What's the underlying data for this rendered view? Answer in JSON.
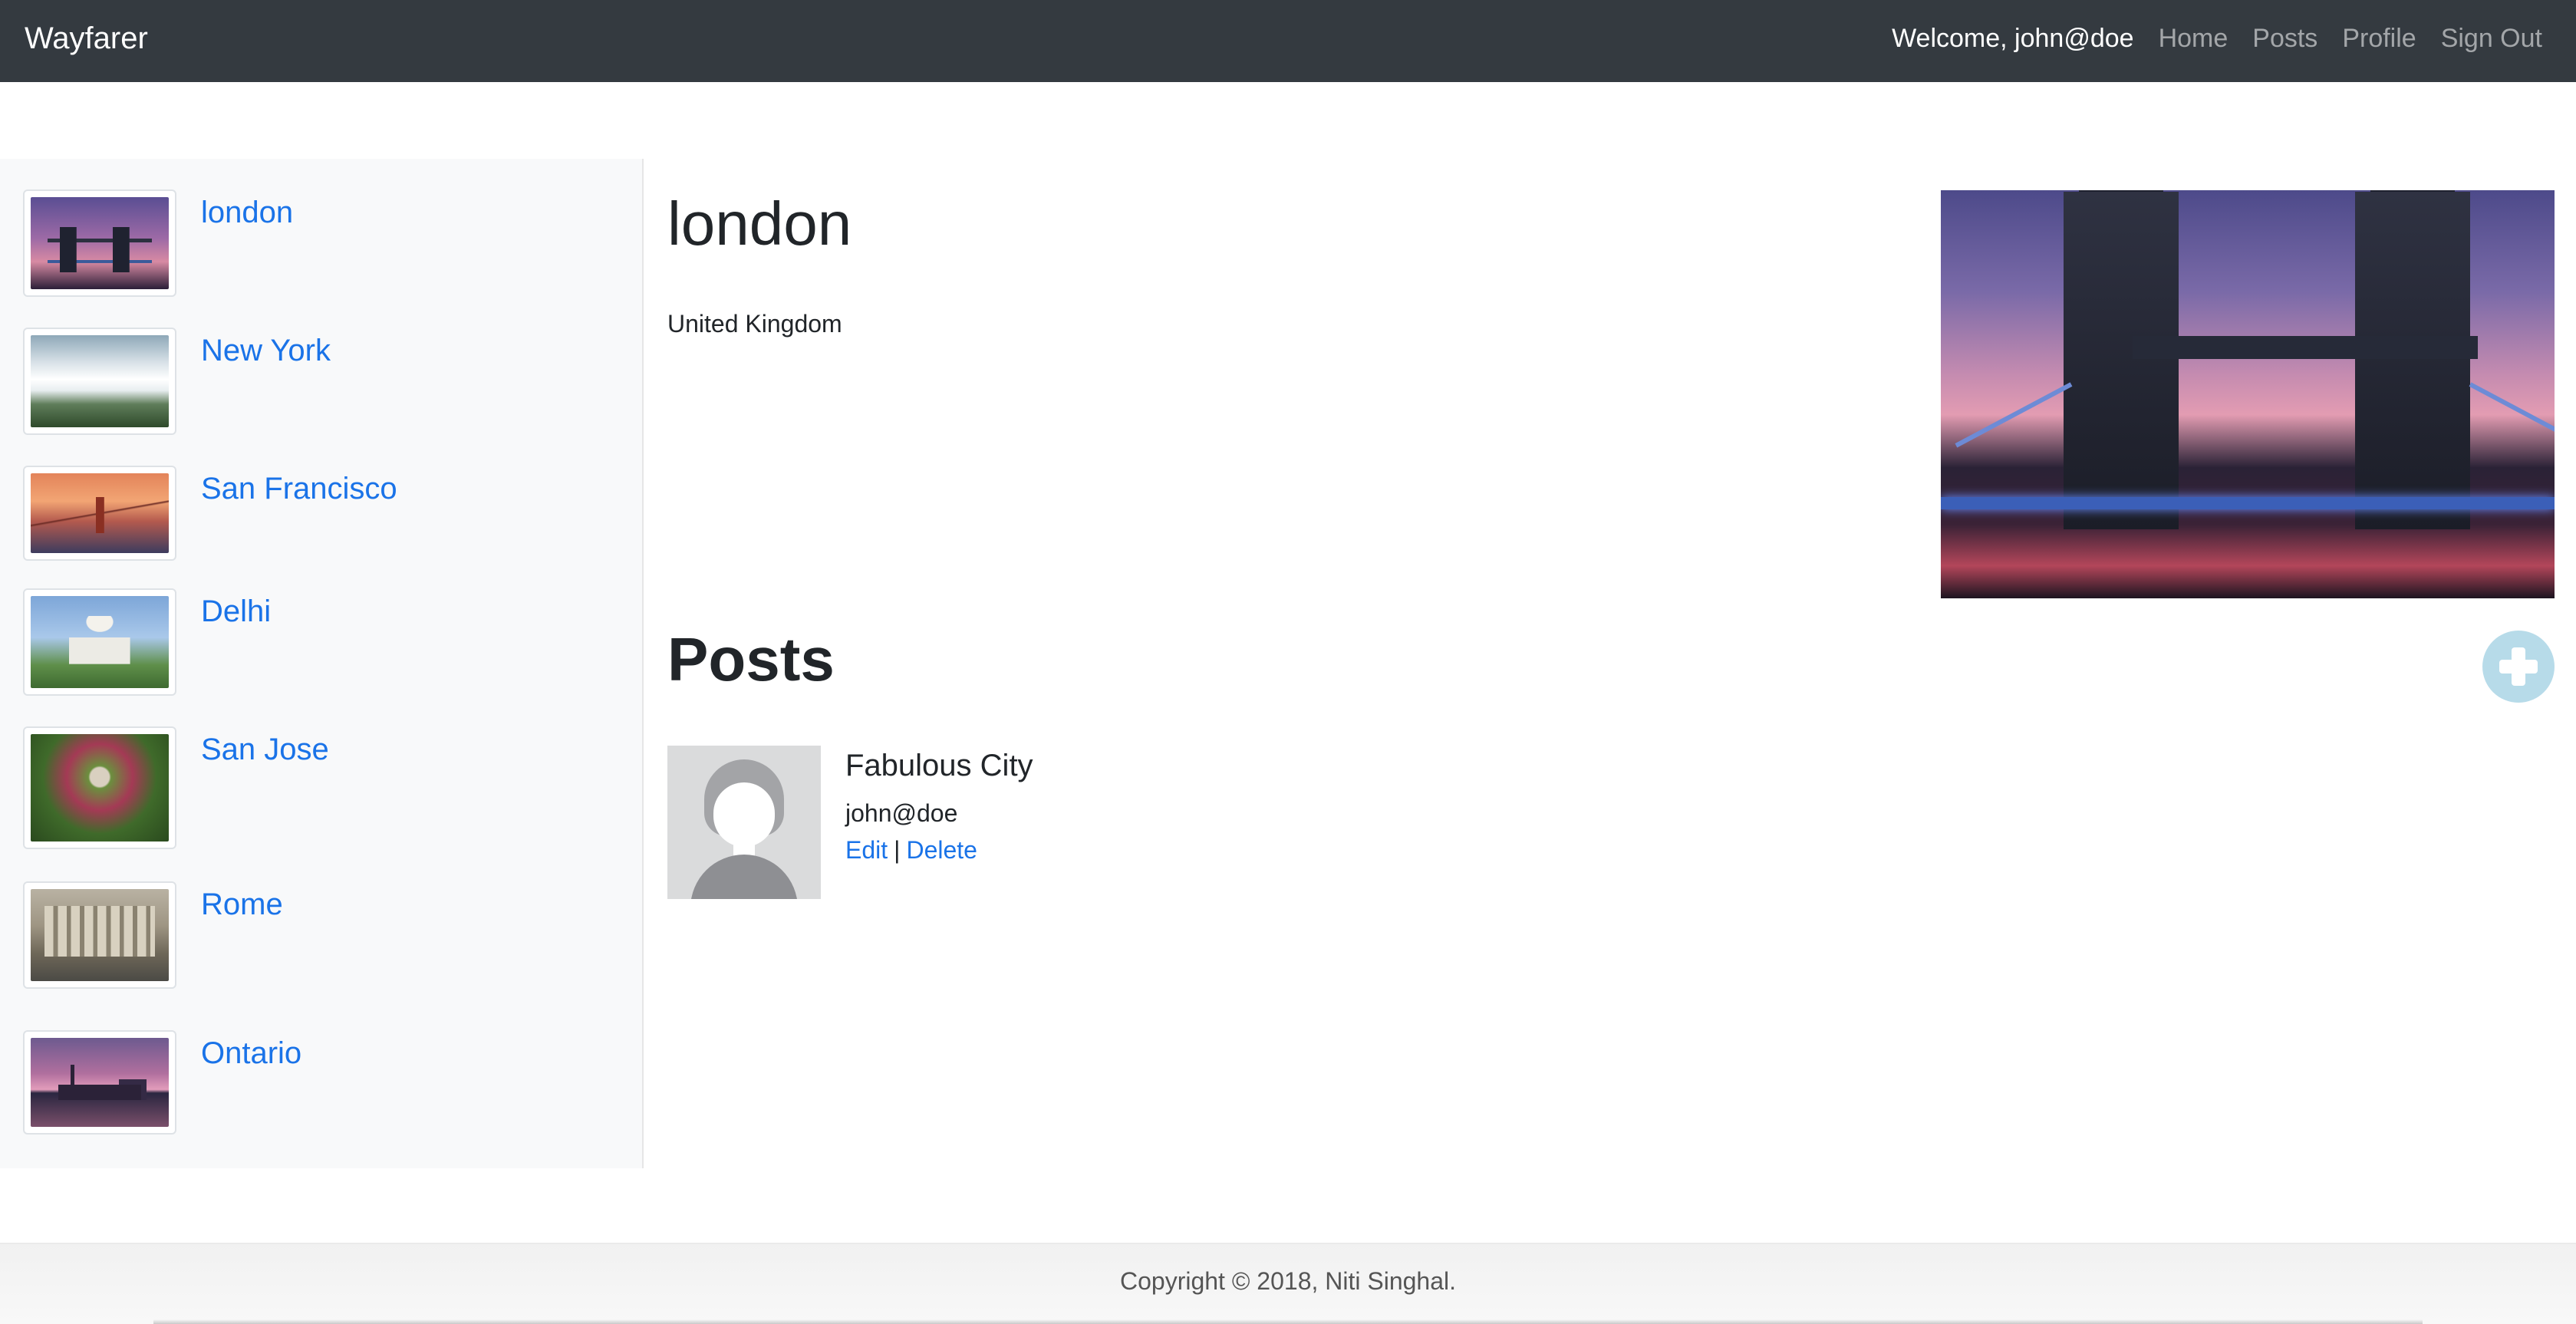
{
  "navbar": {
    "brand": "Wayfarer",
    "welcome": "Welcome, john@doe",
    "links": [
      "Home",
      "Posts",
      "Profile",
      "Sign Out"
    ]
  },
  "sidebar": {
    "cities": [
      {
        "name": "london",
        "thumb": "london-thumbnail"
      },
      {
        "name": "New York",
        "thumb": "waterfall-thumbnail"
      },
      {
        "name": "San Francisco",
        "thumb": "golden-gate-thumbnail"
      },
      {
        "name": "Delhi",
        "thumb": "taj-mahal-thumbnail"
      },
      {
        "name": "San Jose",
        "thumb": "rose-garden-thumbnail"
      },
      {
        "name": "Rome",
        "thumb": "trevi-fountain-thumbnail"
      },
      {
        "name": "Ontario",
        "thumb": "toronto-skyline-thumbnail"
      }
    ]
  },
  "main": {
    "city_title": "london",
    "country": "United Kingdom",
    "hero_image": "tower-bridge-photo",
    "posts_heading": "Posts",
    "add_icon": "plus-circle-icon",
    "posts": [
      {
        "title": "Fabulous City",
        "author": "john@doe",
        "edit_label": "Edit",
        "separator": "|",
        "delete_label": "Delete",
        "avatar": "default-user-avatar"
      }
    ]
  },
  "footer": {
    "text": "Copyright © 2018, Niti Singhal."
  },
  "colors": {
    "navbar_bg": "#343a40",
    "link": "#1a73e8",
    "sidebar_bg": "#f8f9fa",
    "add_button": "#b7dbe9"
  }
}
